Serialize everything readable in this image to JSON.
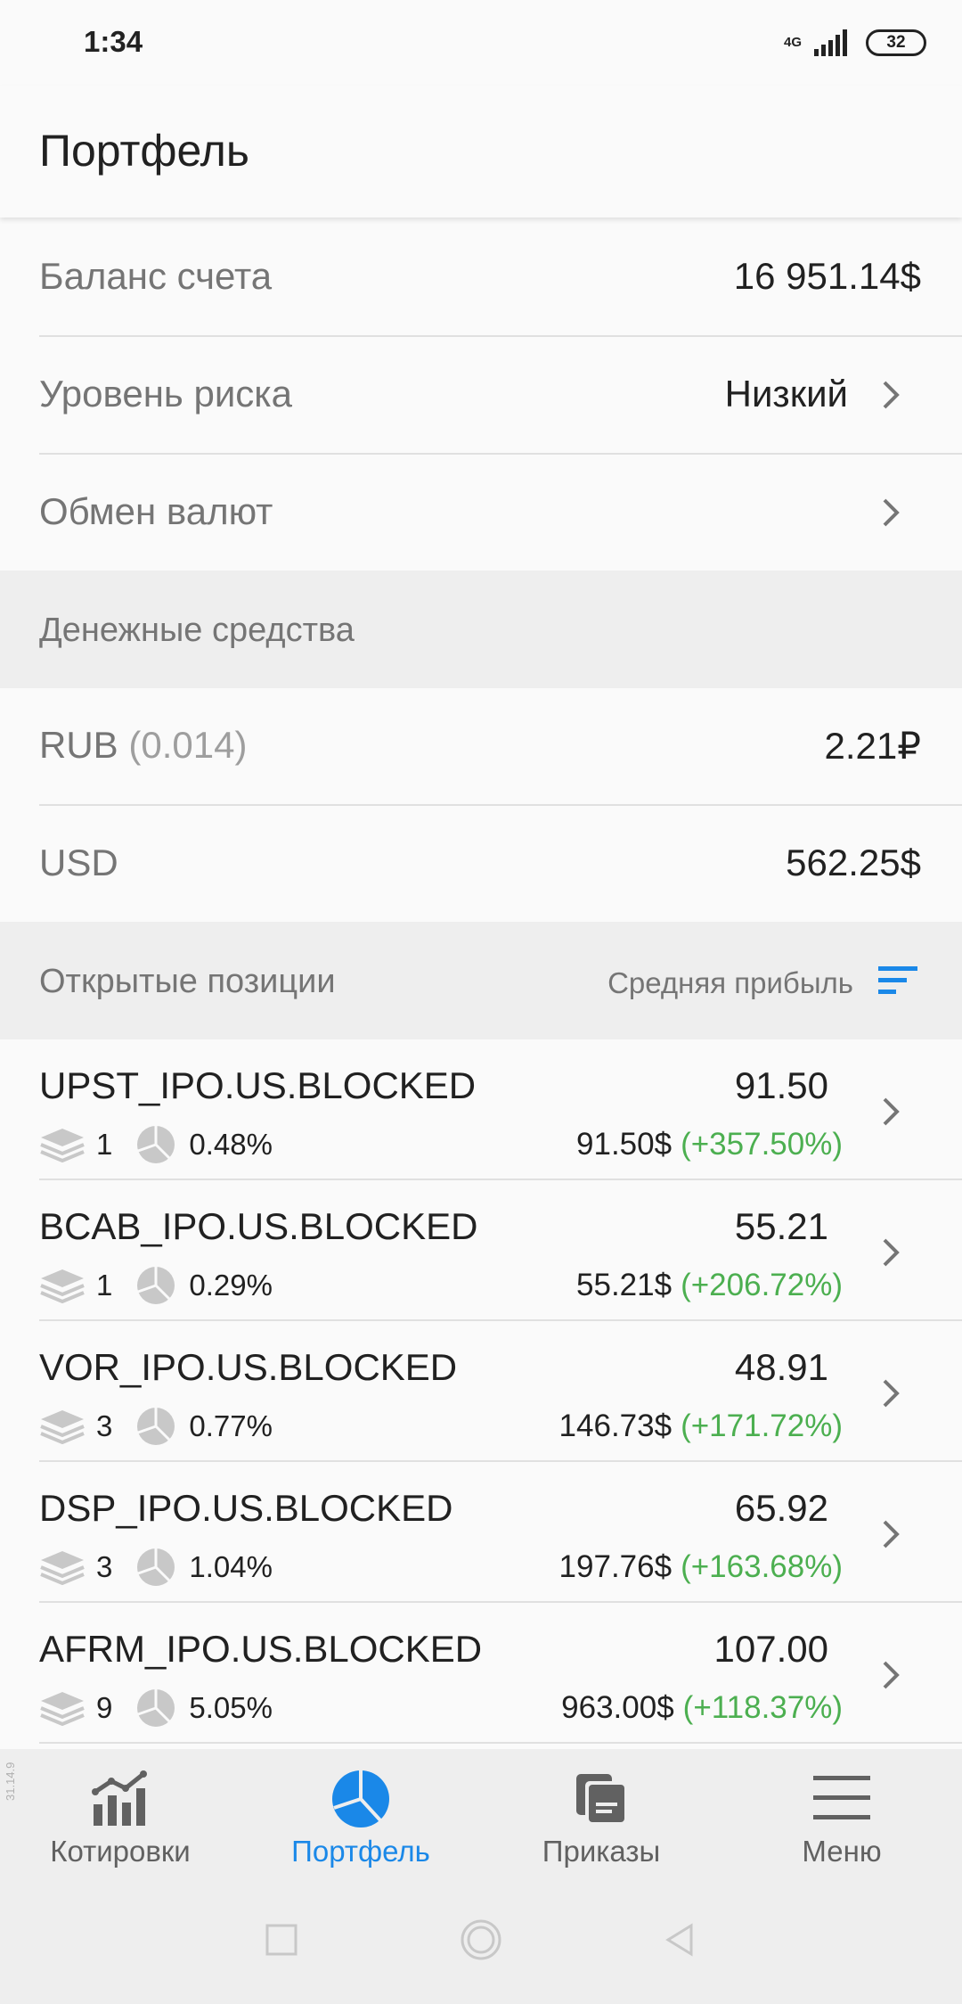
{
  "status_bar": {
    "time": "1:34",
    "network": "4G",
    "battery": "32"
  },
  "app_bar": {
    "title": "Портфель"
  },
  "account": {
    "balance_label": "Баланс счета",
    "balance_value": "16 951.14$",
    "risk_label": "Уровень риска",
    "risk_value": "Низкий",
    "exchange_label": "Обмен валют"
  },
  "cash": {
    "header": "Денежные средства",
    "rub_label": "RUB",
    "rub_rate": "(0.014)",
    "rub_value": "2.21₽",
    "usd_label": "USD",
    "usd_value": "562.25$"
  },
  "positions": {
    "header": "Открытые позиции",
    "sort_label": "Средняя прибыль",
    "items": [
      {
        "name": "UPST_IPO.US.BLOCKED",
        "qty": "1",
        "share": "0.48%",
        "price": "91.50",
        "amount": "91.50$",
        "change": "(+357.50%)"
      },
      {
        "name": "BCAB_IPO.US.BLOCKED",
        "qty": "1",
        "share": "0.29%",
        "price": "55.21",
        "amount": "55.21$",
        "change": "(+206.72%)"
      },
      {
        "name": "VOR_IPO.US.BLOCKED",
        "qty": "3",
        "share": "0.77%",
        "price": "48.91",
        "amount": "146.73$",
        "change": "(+171.72%)"
      },
      {
        "name": "DSP_IPO.US.BLOCKED",
        "qty": "3",
        "share": "1.04%",
        "price": "65.92",
        "amount": "197.76$",
        "change": "(+163.68%)"
      },
      {
        "name": "AFRM_IPO.US.BLOCKED",
        "qty": "9",
        "share": "5.05%",
        "price": "107.00",
        "amount": "963.00$",
        "change": "(+118.37%)"
      }
    ]
  },
  "bottom_nav": {
    "items": [
      {
        "label": "Котировки",
        "icon": "chart-icon"
      },
      {
        "label": "Портфель",
        "icon": "pie-chart-icon",
        "active": true
      },
      {
        "label": "Приказы",
        "icon": "orders-icon"
      },
      {
        "label": "Меню",
        "icon": "menu-icon"
      }
    ]
  },
  "version": "31.14.9",
  "colors": {
    "accent": "#1a88e8",
    "positive": "#4caf50",
    "text_secondary": "#757575"
  }
}
